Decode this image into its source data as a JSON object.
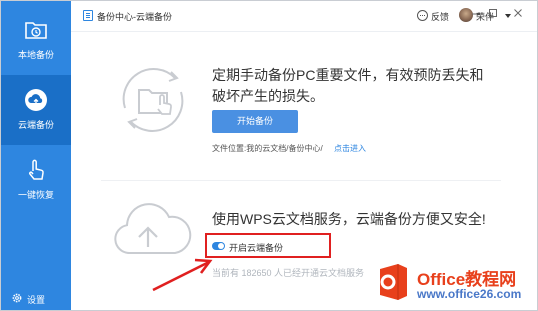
{
  "window": {
    "title": "备份中心-云端备份",
    "feedback_label": "反馈",
    "user_name": "荣伴"
  },
  "sidebar": {
    "items": [
      {
        "label": "本地备份",
        "icon": "folder-clock-icon"
      },
      {
        "label": "云端备份",
        "icon": "cloud-upload-icon"
      },
      {
        "label": "一键恢复",
        "icon": "hand-pointer-icon"
      }
    ],
    "settings_label": "设置"
  },
  "manual_backup": {
    "description": "定期手动备份PC重要文件，有效预防丢失和破坏产生的损失。",
    "start_button": "开始备份",
    "location_label": "文件位置:我的云文档/备份中心/",
    "location_link": "点击进入"
  },
  "cloud_backup": {
    "description": "使用WPS云文档服务，云端备份方便又安全!",
    "toggle_label": "开启云端备份",
    "toggle_on": true,
    "users_text": "当前有 182650 人已经开通云文档服务"
  },
  "watermark": {
    "title": "Office教程网",
    "url": "www.office26.com"
  },
  "colors": {
    "sidebar": "#2e86e0",
    "sidebar_active": "#1a6fc7",
    "primary_button": "#4a90e2",
    "highlight": "#e02020"
  }
}
